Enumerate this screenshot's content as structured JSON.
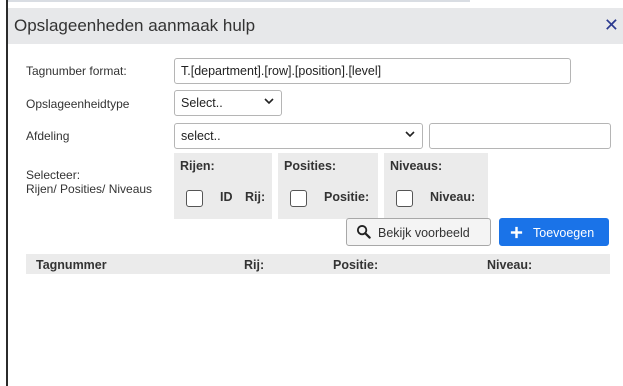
{
  "dialog": {
    "title": "Opslageenheden aanmaak hulp",
    "close_glyph": "✕"
  },
  "form": {
    "tagnumber_label": "Tagnumber format:",
    "tagnumber_value": "T.[department].[row].[position].[level]",
    "type_label": "Opslageenheidtype",
    "type_value": "Select..",
    "department_label": "Afdeling",
    "department_value": "select..",
    "department_extra_value": "",
    "select_label_line1": "Selecteer:",
    "select_label_line2": "Rijen/ Posities/ Niveaus"
  },
  "groups": {
    "rows_title": "Rijen:",
    "rows_check_id_label": "ID",
    "rows_check_row_label": "Rij:",
    "positions_title": "Posities:",
    "positions_check_label": "Positie:",
    "levels_title": "Niveaus:",
    "levels_check_label": "Niveau:"
  },
  "buttons": {
    "preview_label": "Bekijk voorbeeld",
    "add_label": "Toevoegen"
  },
  "icons": {
    "search": "search-icon",
    "plus": "plus-icon",
    "chevron": "chevron-down-icon",
    "close": "close-icon"
  },
  "table": {
    "columns": [
      "Tagnummer",
      "Rij:",
      "Positie:",
      "Niveau:"
    ]
  },
  "colors": {
    "accent": "#1a73e8",
    "close": "#2b3a8f"
  }
}
